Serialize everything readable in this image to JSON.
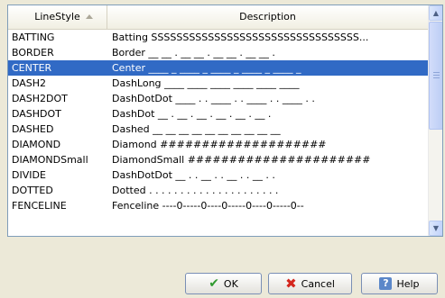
{
  "grid": {
    "columns": {
      "linestyle": "LineStyle",
      "description": "Description"
    },
    "rows": [
      {
        "name": "BATTING",
        "description": "Batting SSSSSSSSSSSSSSSSSSSSSSSSSSSSSSSSS...",
        "selected": false
      },
      {
        "name": "BORDER",
        "description": "Border __ __ . __ __ . __ __ . __ __ .",
        "selected": false
      },
      {
        "name": "CENTER",
        "description": "Center ____ _ ____ _ ____ _ ____ _ ____ _",
        "selected": true
      },
      {
        "name": "DASH2",
        "description": "DashLong ____ ____ ____ ____ ____ ____",
        "selected": false
      },
      {
        "name": "DASH2DOT",
        "description": "DashDotDot ____ . . ____ . . ____ . . ____ . .",
        "selected": false
      },
      {
        "name": "DASHDOT",
        "description": "DashDot __ . __ . __ . __ . __ . __ .",
        "selected": false
      },
      {
        "name": "DASHED",
        "description": "Dashed __ __ __ __ __ __ __ __ __ __",
        "selected": false
      },
      {
        "name": "DIAMOND",
        "description": "Diamond ####################",
        "selected": false
      },
      {
        "name": "DIAMONDSmall",
        "description": "DiamondSmall ######################",
        "selected": false
      },
      {
        "name": "DIVIDE",
        "description": "DashDotDot __ . . __ . . __ . . __ . .",
        "selected": false
      },
      {
        "name": "DOTTED",
        "description": "Dotted . . . . . . . . . . . . . . . . . . . . .",
        "selected": false
      },
      {
        "name": "FENCELINE",
        "description": "Fenceline ----0-----0----0-----0----0-----0--",
        "selected": false
      }
    ]
  },
  "buttons": {
    "ok": "OK",
    "cancel": "Cancel",
    "help": "Help"
  },
  "icons": {
    "ok": "checkmark-icon",
    "cancel": "x-icon",
    "help": "question-icon"
  },
  "colors": {
    "selection": "#316ac5",
    "ok_icon": "#2f9a2f",
    "cancel_icon": "#d4261d"
  }
}
